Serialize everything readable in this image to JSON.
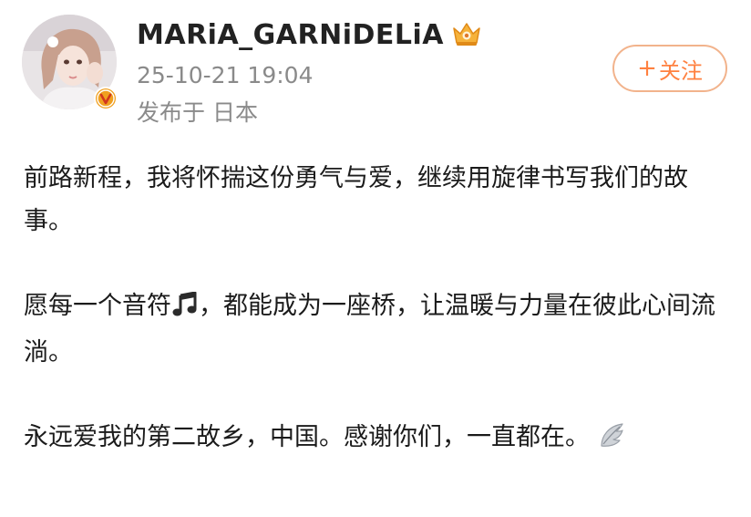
{
  "profile": {
    "username": "MARiA_GARNiDELiA",
    "timestamp": "25-10-21 19:04",
    "source": "发布于 日本",
    "avatar_icon": "profile-photo",
    "verified_icon": "verified-v-badge",
    "crown_icon": "crown-badge"
  },
  "follow_button": {
    "plus": "+",
    "label": "关注"
  },
  "post": {
    "p1": "前路新程，我将怀揣这份勇气与爱，继续用旋律书写我们的故事。",
    "p2_before": "愿每一个音符",
    "p2_icon": "music-note-icon",
    "p2_after": "，都能成为一座桥，让温暖与力量在彼此心间流淌。",
    "p3": "永远爱我的第二故乡，中国。感谢你们，一直都在。",
    "p3_icon": "wing-icon"
  },
  "colors": {
    "accent": "#ff8140",
    "follow_border": "#f2b38c",
    "meta_text": "#8a8a8a",
    "verified": "#f0a020"
  }
}
